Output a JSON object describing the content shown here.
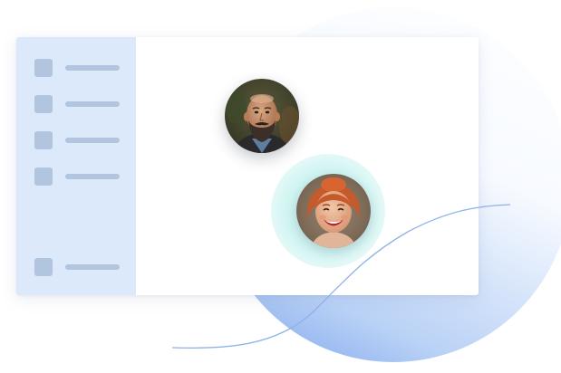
{
  "colors": {
    "sidebar_bg": "#dce9fb",
    "sidebar_placeholder": "#b2c5de",
    "card_bg": "#ffffff",
    "accent_blue": "#78a0eb",
    "halo_teal": "#b0ece8",
    "curve_stroke": "#8fb1ea"
  },
  "sidebar": {
    "items": [
      {
        "icon": "placeholder-square-icon"
      },
      {
        "icon": "placeholder-square-icon"
      },
      {
        "icon": "placeholder-square-icon"
      },
      {
        "icon": "placeholder-square-icon"
      },
      {
        "icon": "placeholder-square-icon"
      }
    ]
  },
  "avatars": [
    {
      "icon": "bearded-man-avatar"
    },
    {
      "icon": "smiling-redhead-woman-avatar"
    }
  ]
}
